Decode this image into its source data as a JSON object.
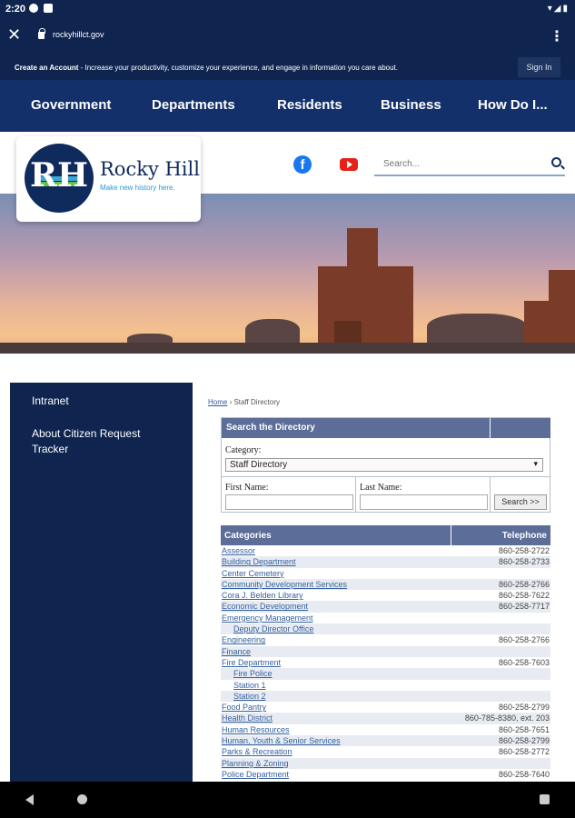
{
  "status_bar": {
    "time": "2:20"
  },
  "browser": {
    "url": "rockyhillct.gov"
  },
  "account": {
    "title": "Create an Account",
    "message": " - Increase your productivity, customize your experience, and engage in information you care about.",
    "signin_label": "Sign In"
  },
  "nav": {
    "items": [
      "Government",
      "Departments",
      "Residents",
      "Business",
      "How Do I..."
    ]
  },
  "header": {
    "logo_name": "Rocky Hill",
    "logo_tagline": "Make new history here.",
    "search_placeholder": "Search..."
  },
  "sidebar": {
    "items": [
      "Intranet",
      "About Citizen Request Tracker"
    ]
  },
  "breadcrumb": {
    "home": "Home",
    "current": "Staff Directory"
  },
  "directory": {
    "title": "Search the Directory",
    "category_label": "Category:",
    "category_value": "Staff Directory",
    "first_name_label": "First Name:",
    "last_name_label": "Last Name:",
    "search_button": "Search >>"
  },
  "categories": {
    "col_name": "Categories",
    "col_phone": "Telephone",
    "rows": [
      {
        "name": "Assessor",
        "tel": "860-258-2722",
        "sub": false
      },
      {
        "name": "Building Department",
        "tel": "860-258-2733",
        "sub": false
      },
      {
        "name": "Center Cemetery",
        "tel": "",
        "sub": false
      },
      {
        "name": "Community Development Services",
        "tel": "860-258-2766",
        "sub": false
      },
      {
        "name": "Cora J. Belden Library",
        "tel": "860-258-7622",
        "sub": false
      },
      {
        "name": "Economic Development",
        "tel": "860-258-7717",
        "sub": false
      },
      {
        "name": "Emergency Management",
        "tel": "",
        "sub": false
      },
      {
        "name": "Deputy Director Office",
        "tel": "",
        "sub": true
      },
      {
        "name": "Engineering",
        "tel": "860-258-2766",
        "sub": false
      },
      {
        "name": "Finance",
        "tel": "",
        "sub": false
      },
      {
        "name": "Fire Department",
        "tel": "860-258-7603",
        "sub": false
      },
      {
        "name": "Fire Police",
        "tel": "",
        "sub": true
      },
      {
        "name": "Station 1",
        "tel": "",
        "sub": true
      },
      {
        "name": "Station 2",
        "tel": "",
        "sub": true
      },
      {
        "name": "Food Pantry",
        "tel": "860-258-2799",
        "sub": false
      },
      {
        "name": "Health District",
        "tel": "860-785-8380, ext. 203",
        "sub": false
      },
      {
        "name": "Human Resources",
        "tel": "860-258-7651",
        "sub": false
      },
      {
        "name": "Human, Youth & Senior Services",
        "tel": "860-258-2799",
        "sub": false
      },
      {
        "name": "Parks & Recreation",
        "tel": "860-258-2772",
        "sub": false
      },
      {
        "name": "Planning & Zoning",
        "tel": "",
        "sub": false
      },
      {
        "name": "Police Department",
        "tel": "860-258-7640",
        "sub": false
      }
    ]
  }
}
